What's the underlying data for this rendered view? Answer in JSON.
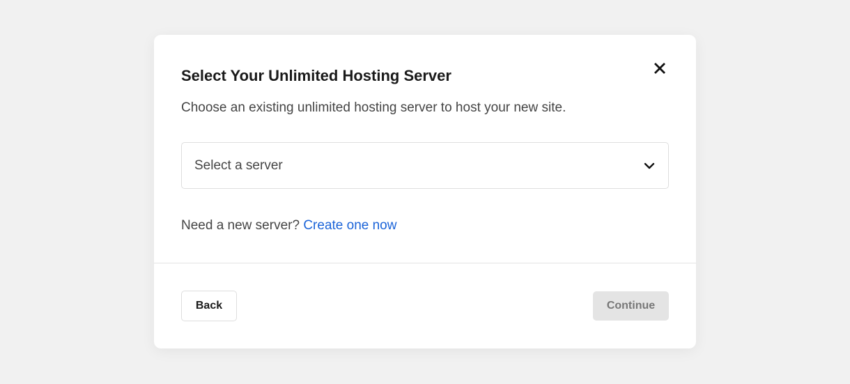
{
  "dialog": {
    "title": "Select Your Unlimited Hosting Server",
    "subtitle": "Choose an existing unlimited hosting server to host your new site.",
    "close_icon": "close-icon",
    "server_select": {
      "selected_value": "Select a server",
      "icon": "chevron-down-icon"
    },
    "new_server": {
      "prompt": "Need a new server?",
      "link_label": "Create one now"
    },
    "footer": {
      "back_label": "Back",
      "continue_label": "Continue"
    }
  },
  "colors": {
    "background": "#f1f1f1",
    "link": "#1a63d8",
    "disabled_button": "#e4e4e4"
  }
}
